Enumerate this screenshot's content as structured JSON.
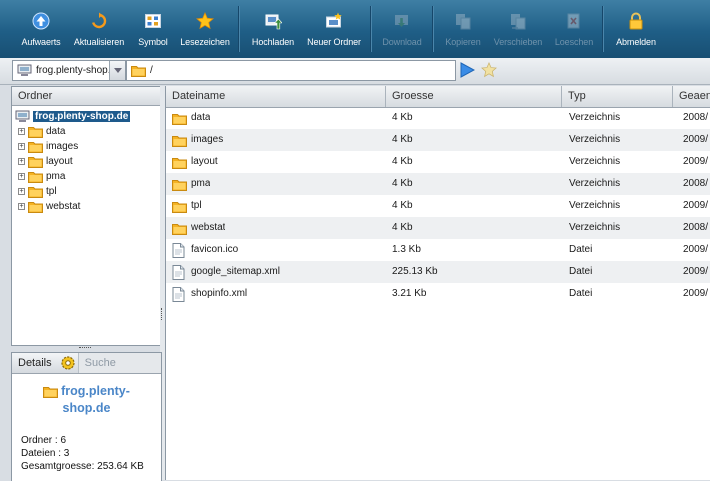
{
  "toolbar": {
    "buttons": [
      {
        "label": "Aufwaerts",
        "icon": "up-arrow-icon",
        "enabled": true
      },
      {
        "label": "Aktualisieren",
        "icon": "refresh-icon",
        "enabled": true
      },
      {
        "label": "Symbol",
        "icon": "view-icons-icon",
        "enabled": true
      },
      {
        "label": "Lesezeichen",
        "icon": "bookmark-star-icon",
        "enabled": true
      },
      {
        "label": "Hochladen",
        "icon": "upload-icon",
        "enabled": true
      },
      {
        "label": "Neuer Ordner",
        "icon": "new-folder-icon",
        "enabled": true
      },
      {
        "label": "Download",
        "icon": "download-icon",
        "enabled": false
      },
      {
        "label": "Kopieren",
        "icon": "copy-icon",
        "enabled": false
      },
      {
        "label": "Verschieben",
        "icon": "move-icon",
        "enabled": false
      },
      {
        "label": "Loeschen",
        "icon": "delete-icon",
        "enabled": false
      },
      {
        "label": "Abmelden",
        "icon": "logout-lock-icon",
        "enabled": true
      }
    ]
  },
  "addressbar": {
    "server": "frog.plenty-shop.de",
    "path": "/"
  },
  "tree": {
    "title": "Ordner",
    "root": "frog.plenty-shop.de",
    "folders": [
      "data",
      "images",
      "layout",
      "pma",
      "tpl",
      "webstat"
    ]
  },
  "details": {
    "tab_details": "Details",
    "tab_search": "Suche",
    "name_line1": "frog.plenty-",
    "name_line2": "shop.de",
    "folders_line": "Ordner : 6",
    "files_line": "Dateien : 3",
    "total_line": "Gesamtgroesse: 253.64 KB"
  },
  "filelist": {
    "columns": [
      "Dateiname",
      "Groesse",
      "Typ",
      "Geaen"
    ],
    "rows": [
      {
        "name": "data",
        "size": "4 Kb",
        "type": "Verzeichnis",
        "date": "2008/",
        "kind": "folder"
      },
      {
        "name": "images",
        "size": "4 Kb",
        "type": "Verzeichnis",
        "date": "2009/",
        "kind": "folder"
      },
      {
        "name": "layout",
        "size": "4 Kb",
        "type": "Verzeichnis",
        "date": "2009/",
        "kind": "folder"
      },
      {
        "name": "pma",
        "size": "4 Kb",
        "type": "Verzeichnis",
        "date": "2008/",
        "kind": "folder"
      },
      {
        "name": "tpl",
        "size": "4 Kb",
        "type": "Verzeichnis",
        "date": "2009/",
        "kind": "folder"
      },
      {
        "name": "webstat",
        "size": "4 Kb",
        "type": "Verzeichnis",
        "date": "2008/",
        "kind": "folder"
      },
      {
        "name": "favicon.ico",
        "size": "1.3 Kb",
        "type": "Datei",
        "date": "2009/",
        "kind": "file"
      },
      {
        "name": "google_sitemap.xml",
        "size": "225.13 Kb",
        "type": "Datei",
        "date": "2009/",
        "kind": "file"
      },
      {
        "name": "shopinfo.xml",
        "size": "3.21 Kb",
        "type": "Datei",
        "date": "2009/",
        "kind": "file"
      }
    ]
  },
  "colors": {
    "toolbar": "#1f5e86",
    "selection": "#1e5a8c",
    "folder": "#f5b324",
    "accent_blue": "#4a86c8"
  }
}
